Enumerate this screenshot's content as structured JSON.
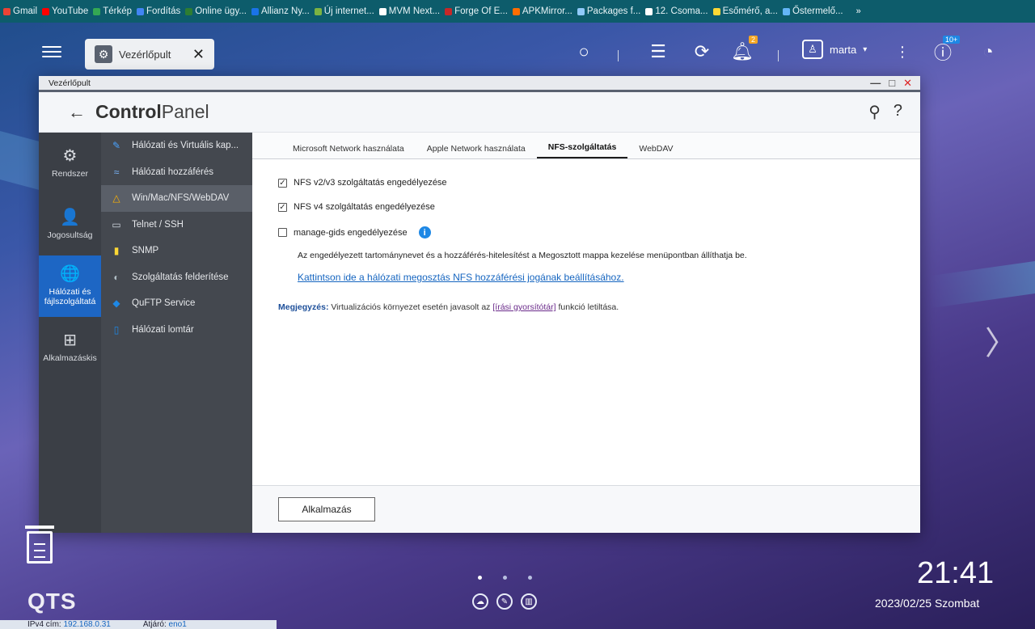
{
  "bookmarks": [
    {
      "label": "Gmail",
      "color": "#ea4335"
    },
    {
      "label": "YouTube",
      "color": "#ff0000"
    },
    {
      "label": "Térkép",
      "color": "#34a853"
    },
    {
      "label": "Fordítás",
      "color": "#4285f4"
    },
    {
      "label": "Online ügy...",
      "color": "#2e7d32"
    },
    {
      "label": "Allianz Ny...",
      "color": "#1a73e8"
    },
    {
      "label": "Új internet...",
      "color": "#7cb342"
    },
    {
      "label": "MVM Next...",
      "color": "#ffffff"
    },
    {
      "label": "Forge Of E...",
      "color": "#c62828"
    },
    {
      "label": "APKMirror...",
      "color": "#ff6d00"
    },
    {
      "label": "Packages f...",
      "color": "#90caf9"
    },
    {
      "label": "12. Csoma...",
      "color": "#ffffff"
    },
    {
      "label": "Esőmérő, a...",
      "color": "#fdd835"
    },
    {
      "label": "Őstermelő...",
      "color": "#64b5f6"
    }
  ],
  "bookmarks_more": "»",
  "topbar": {
    "tab_title": "Vezérlőpult",
    "tab_close": "✕",
    "notif_badge": "2",
    "user_name": "marta",
    "user_caret": "▾",
    "update_badge": "10+"
  },
  "window": {
    "title": "Vezérlőpult",
    "min": "—",
    "max": "□",
    "close": "✕"
  },
  "controlpanel": {
    "back": "←",
    "title_bold": "Control",
    "title_light": "Panel"
  },
  "side1": [
    {
      "label": "Rendszer",
      "icon": "⚙",
      "name": "system"
    },
    {
      "label": "Jogosultság",
      "icon": "👤",
      "name": "privilege"
    },
    {
      "label": "Hálózati és fájlszolgáltatá",
      "icon": "🌐",
      "name": "network-file-services"
    },
    {
      "label": "Alkalmazáskis",
      "icon": "⊞",
      "name": "applications"
    }
  ],
  "side2": [
    {
      "label": "Hálózati és Virtuális kap...",
      "icon": "✎",
      "color": "#4aa3ff"
    },
    {
      "label": "Hálózati hozzáférés",
      "icon": "≈",
      "color": "#7ab8ff"
    },
    {
      "label": "Win/Mac/NFS/WebDAV",
      "icon": "△",
      "color": "#ffb300"
    },
    {
      "label": "Telnet / SSH",
      "icon": "▭",
      "color": "#cfd6de"
    },
    {
      "label": "SNMP",
      "icon": "▮",
      "color": "#fdd835"
    },
    {
      "label": "Szolgáltatás felderítése",
      "icon": "◐",
      "color": "#b0bec5"
    },
    {
      "label": "QuFTP Service",
      "icon": "◆",
      "color": "#1e88e5"
    },
    {
      "label": "Hálózati lomtár",
      "icon": "▯",
      "color": "#1e88e5"
    }
  ],
  "tabs": [
    "Microsoft Network használata",
    "Apple Network használata",
    "NFS-szolgáltatás",
    "WebDAV"
  ],
  "options": {
    "nfs_v2v3": "NFS v2/v3 szolgáltatás engedélyezése",
    "nfs_v4": "NFS v4 szolgáltatás engedélyezése",
    "manage_gids": "manage-gids engedélyezése"
  },
  "description": "Az engedélyezett tartománynevet és a hozzáférés-hitelesítést a Megosztott mappa kezelése menüpontban állíthatja be.",
  "link": "Kattintson ide a hálózati megosztás NFS hozzáférési jogának beállításához.",
  "note": {
    "label": "Megjegyzés:",
    "before": " Virtualizációs környezet esetén javasolt az ",
    "link": "[írási gyorsítótár]",
    "after": " funkció letiltása."
  },
  "apply_button": "Alkalmazás",
  "desktop": {
    "brand": "QTS",
    "time": "21:41",
    "date": "2023/02/25 Szombat"
  },
  "status": {
    "ip_label": "IPv4 cím:",
    "ip_value": "192.168.0.31",
    "gw_label": "Átjáró:",
    "gw_value": "eno1"
  }
}
